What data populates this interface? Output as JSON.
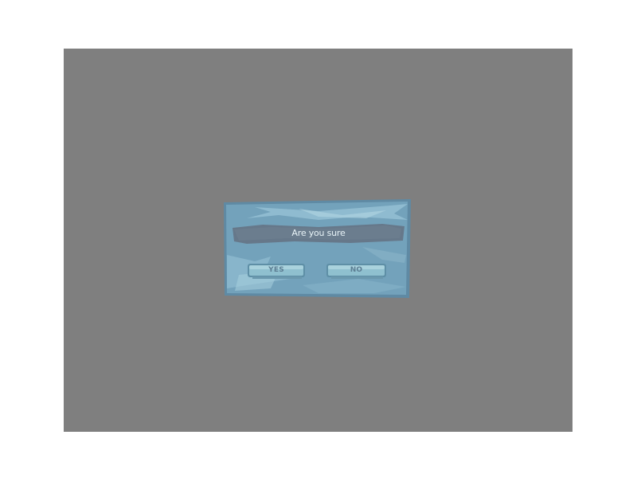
{
  "dialog": {
    "message": "Are you sure",
    "yes_label": "YES",
    "no_label": "NO"
  },
  "colors": {
    "overlay": "#7f7f7f",
    "panel": "#6f9cb6",
    "panel_light": "#9ac2d4",
    "banner": "#67798a",
    "button": "#88b8c8"
  }
}
